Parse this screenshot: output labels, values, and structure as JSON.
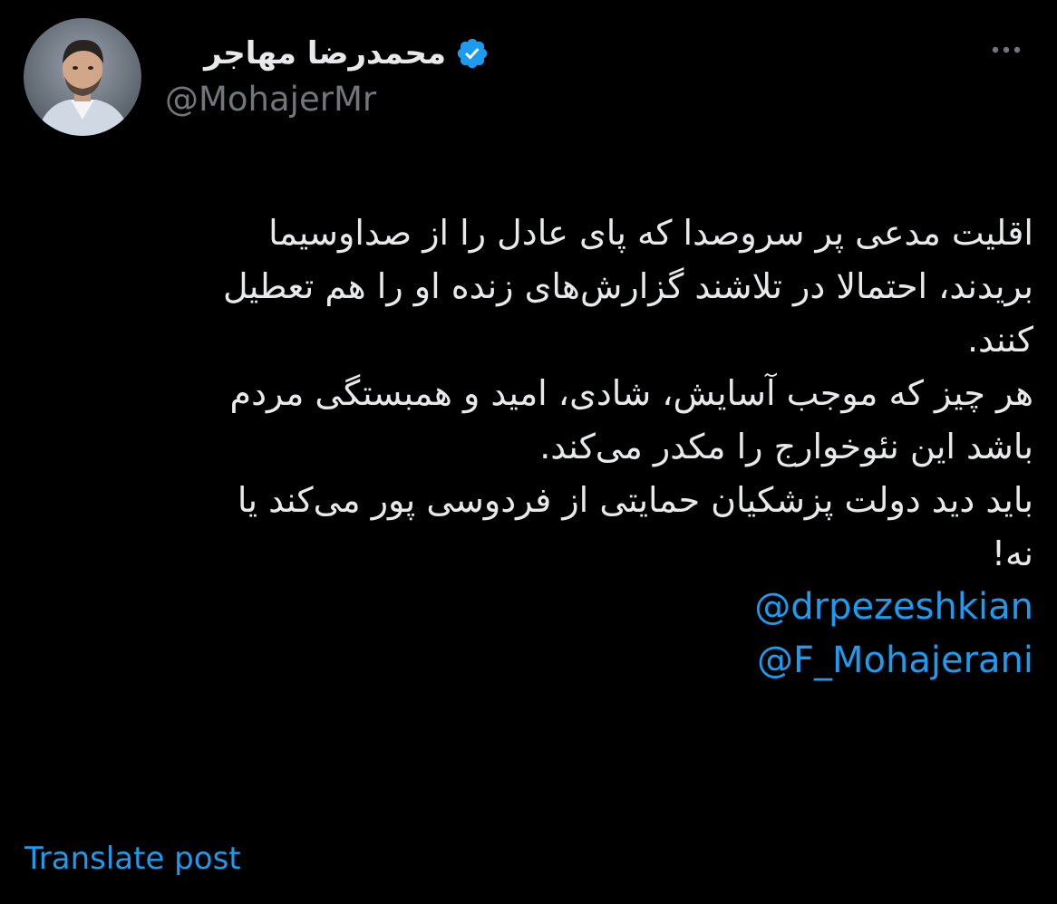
{
  "author": {
    "display_name": "محمدرضا مهاجر",
    "handle": "@MohajerMr",
    "verified": true,
    "avatar_icon": "profile-photo"
  },
  "post": {
    "lines": [
      "اقلیت مدعی پر سروصدا که پای عادل را از صداوسیما",
      "بریدند، احتمالا در تلاشند گزارش‌های زنده او را هم تعطیل",
      "کنند.",
      "هر چیز که موجب آسایش، شادی، امید و همبستگی مردم",
      "باشد این نئوخوارج را مکدر می‌کند.",
      "باید دید دولت پزشکیان حمایتی از فردوسی پور می‌کند یا",
      "نه!"
    ],
    "mentions": [
      "@drpezeshkian",
      "@F_Mohajerani"
    ]
  },
  "actions": {
    "translate_label": "Translate post",
    "more_icon": "more-horizontal-icon"
  },
  "colors": {
    "background": "#000000",
    "text": "#e7e9ea",
    "secondary_text": "#71767b",
    "link": "#1d9bf0",
    "verified_badge": "#1d9bf0"
  }
}
